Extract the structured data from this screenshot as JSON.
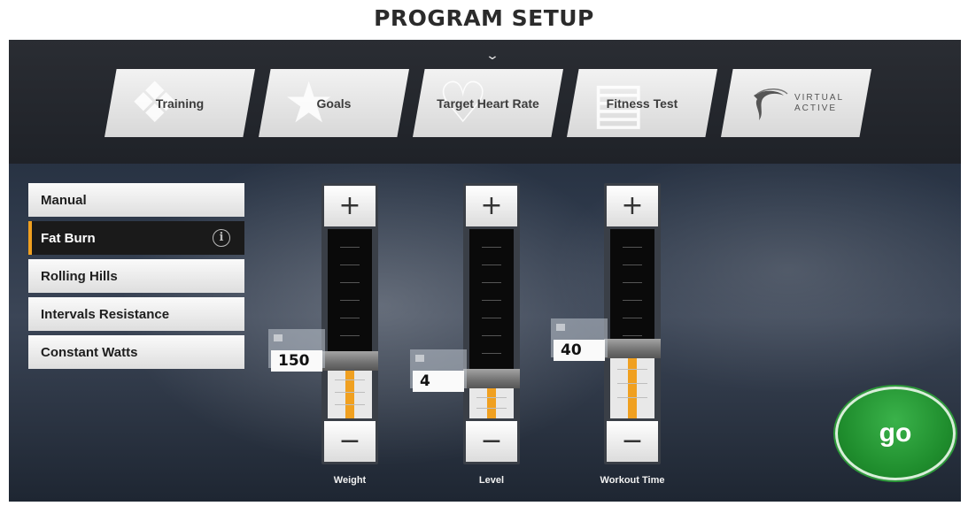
{
  "page": {
    "title": "PROGRAM SETUP"
  },
  "tabs": [
    {
      "label": "Training",
      "icon": "walker-icon"
    },
    {
      "label": "Goals",
      "icon": "trophy-icon"
    },
    {
      "label": "Target Heart Rate",
      "icon": "heart-pulse-icon"
    },
    {
      "label": "Fitness Test",
      "icon": "clipboard-icon"
    },
    {
      "label": "VIRTUAL ACTIVE",
      "icon": "virtual-active-logo"
    }
  ],
  "programs": [
    {
      "label": "Manual"
    },
    {
      "label": "Fat Burn",
      "selected": true
    },
    {
      "label": "Rolling Hills"
    },
    {
      "label": "Intervals Resistance"
    },
    {
      "label": "Constant Watts"
    }
  ],
  "sliders": [
    {
      "label": "Weight",
      "value": "150",
      "plus": "+",
      "minus": "−"
    },
    {
      "label": "Level",
      "value": "4",
      "plus": "+",
      "minus": "−"
    },
    {
      "label": "Workout Time",
      "value": "40",
      "plus": "+",
      "minus": "−"
    }
  ],
  "go": {
    "label": "go"
  },
  "colors": {
    "accent": "#f0a020",
    "go_green": "#1f8d2d"
  }
}
